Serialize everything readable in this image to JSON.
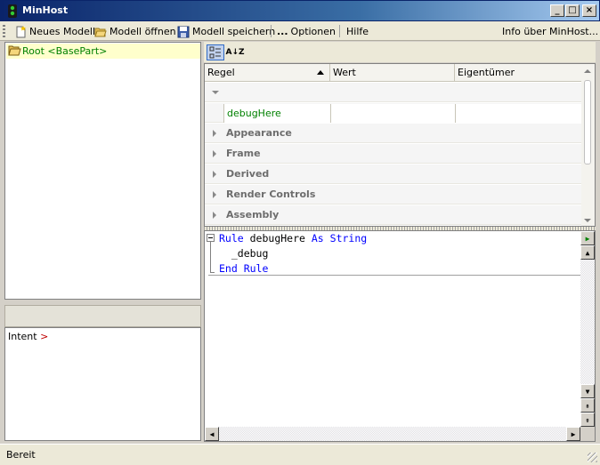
{
  "window": {
    "title": "MinHost",
    "icon": "traffic-light-icon",
    "buttons": {
      "minimize": "_",
      "maximize": "□",
      "close": "×"
    }
  },
  "toolbar": {
    "items": [
      {
        "label": "Neues Modell",
        "icon": "new-document-icon"
      },
      {
        "label": "Modell öffnen",
        "icon": "open-folder-icon"
      },
      {
        "label": "Modell speichern",
        "icon": "floppy-disk-icon"
      },
      {
        "label": "Optionen",
        "icon": "ellipsis-icon"
      },
      {
        "label": "Hilfe"
      }
    ],
    "about": "Info über MinHost..."
  },
  "tree": {
    "root_label": "Root <BasePart>"
  },
  "intent": {
    "label": "Intent",
    "marker": ">"
  },
  "property_grid": {
    "tools": {
      "categorized": "categorized-icon",
      "alphabetical": "A↓Z"
    },
    "columns": [
      "Regel",
      "Wert",
      "Eigentümer"
    ],
    "expanded_row_name": "debugHere",
    "categories": [
      "Appearance",
      "Frame",
      "Derived",
      "Render Controls",
      "Assembly"
    ]
  },
  "code": {
    "lines": [
      {
        "kw1": "Rule",
        "text": " debugHere ",
        "kw2": "As String"
      },
      {
        "text": "  _debug"
      },
      {
        "kw1": "End Rule"
      }
    ]
  },
  "status": {
    "text": "Bereit"
  }
}
